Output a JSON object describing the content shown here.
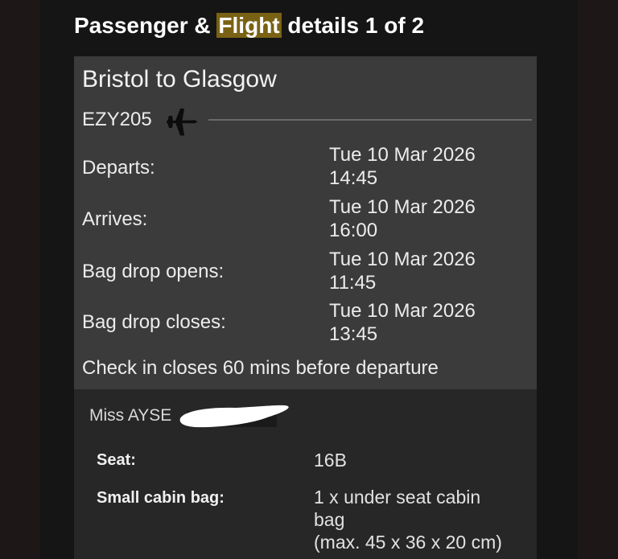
{
  "page": {
    "heading_pre": "Passenger & ",
    "heading_highlight": "Flight",
    "heading_post": " details 1 of 2"
  },
  "flight": {
    "route": "Bristol to Glasgow",
    "number": "EZY205",
    "plane_icon": "plane-icon",
    "rows": [
      {
        "label": "Departs:",
        "date": "Tue 10 Mar 2026",
        "time": "14:45"
      },
      {
        "label": "Arrives:",
        "date": "Tue 10 Mar 2026",
        "time": "16:00"
      },
      {
        "label": "Bag drop opens:",
        "date": "Tue 10 Mar 2026",
        "time": "11:45"
      },
      {
        "label": "Bag drop closes:",
        "date": "Tue 10 Mar 2026",
        "time": "13:45"
      }
    ],
    "checkin_note": "Check in closes 60 mins before departure"
  },
  "passenger": {
    "name": "Miss AYSE",
    "seat_label": "Seat:",
    "seat_value": "16B",
    "bag_label": "Small cabin bag:",
    "bag_value_line1": "1 x under seat cabin",
    "bag_value_line2": "bag",
    "bag_value_line3": "(max. 45 x 36 x 20 cm)"
  },
  "colors": {
    "highlight": "#7a6214",
    "card_bg": "#3b3b3b",
    "passenger_bg": "#272727",
    "page_bg": "#151515"
  }
}
